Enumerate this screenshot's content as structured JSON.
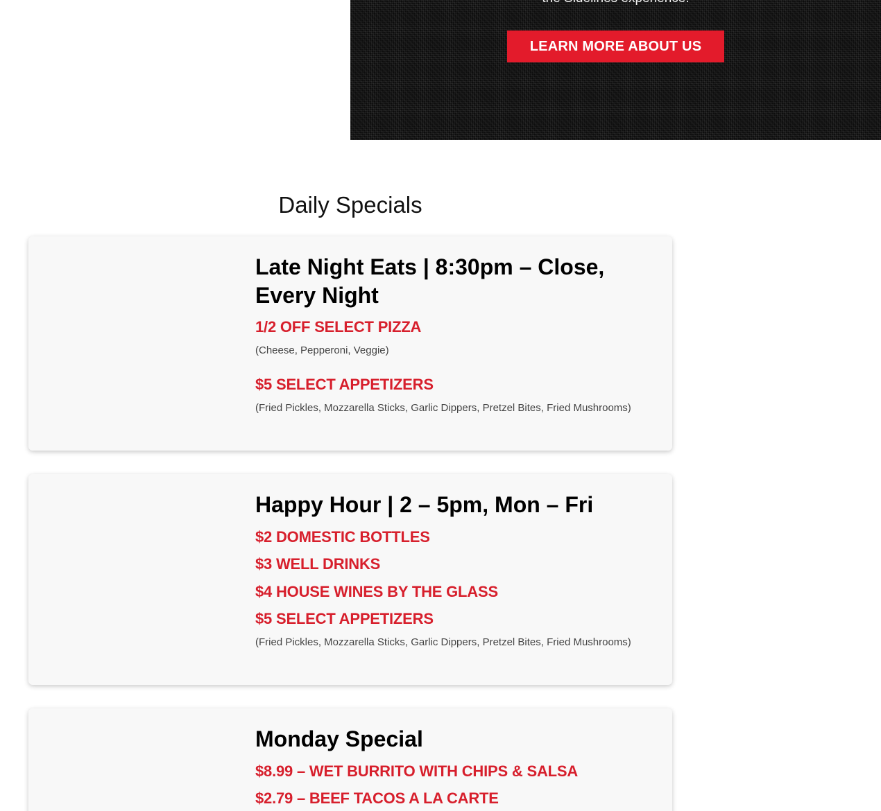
{
  "hero": {
    "tagline": "the Sidelines experience!",
    "button_label": "LEARN MORE ABOUT US"
  },
  "section_title": "Daily Specials",
  "cards": [
    {
      "title": "Late Night Eats | 8:30pm – Close, Every Night",
      "items": [
        {
          "label": "1/2 OFF SELECT PIZZA",
          "note": "(Cheese, Pepperoni, Veggie)"
        },
        {
          "label": "$5 SELECT APPETIZERS",
          "note": "(Fried Pickles, Mozzarella Sticks, Garlic Dippers, Pretzel Bites, Fried Mushrooms)"
        }
      ]
    },
    {
      "title": "Happy Hour | 2 – 5pm, Mon – Fri",
      "items": [
        {
          "label": "$2 DOMESTIC BOTTLES"
        },
        {
          "label": "$3 WELL DRINKS"
        },
        {
          "label": "$4 HOUSE WINES BY THE GLASS"
        },
        {
          "label": "$5 SELECT APPETIZERS",
          "note": "(Fried Pickles, Mozzarella Sticks, Garlic Dippers, Pretzel Bites, Fried Mushrooms)"
        }
      ]
    },
    {
      "title": "Monday Special",
      "items": [
        {
          "label": "$8.99 – WET BURRITO WITH CHIPS & SALSA"
        },
        {
          "label": "$2.79 – BEEF TACOS A LA CARTE"
        }
      ]
    }
  ],
  "colors": {
    "accent": "#e31b2b",
    "item_red": "#d71f2c",
    "hero_bg": "#0d0d0d",
    "card_bg": "#f8f8f8"
  }
}
